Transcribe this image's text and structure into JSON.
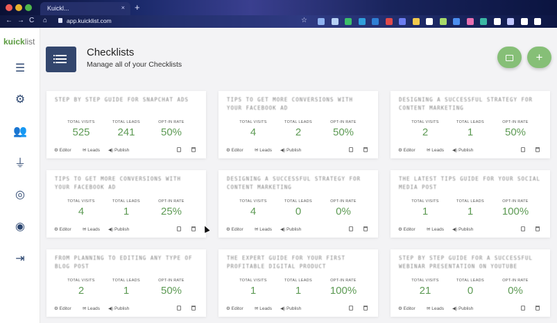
{
  "browser": {
    "tab_title": "Kuickl...",
    "tab_close": "×",
    "new_tab": "+",
    "url": "app.kuicklist.com",
    "nav": {
      "back": "←",
      "forward": "→",
      "reload": "C",
      "home": "⌂",
      "bookmark": "☆"
    },
    "extension_colors": [
      "#8fb2f0",
      "#b7d1f5",
      "#3cbf6a",
      "#2f9edb",
      "#2f7fd4",
      "#e04b4b",
      "#6b7cf0",
      "#f2c94c",
      "#ffffff",
      "#a6d96a",
      "#4b8ef0",
      "#e86fb0",
      "#3bb7a3",
      "#ffffff",
      "#c0c6ff",
      "#ffffff",
      "#ffffff"
    ]
  },
  "sidebar": {
    "logo_primary": "kuick",
    "logo_secondary": "list",
    "items": [
      {
        "icon": "list-icon",
        "glyph": "☰"
      },
      {
        "icon": "gear-icon",
        "glyph": "⚙"
      },
      {
        "icon": "users-icon",
        "glyph": "👥"
      },
      {
        "icon": "plug-icon",
        "glyph": "⏚"
      },
      {
        "icon": "life-ring-icon",
        "glyph": "◎"
      },
      {
        "icon": "user-circle-icon",
        "glyph": "◉"
      },
      {
        "icon": "sign-out-icon",
        "glyph": "⇥"
      }
    ]
  },
  "header": {
    "title": "Checklists",
    "subtitle": "Manage all of your Checklists",
    "add_label": "+"
  },
  "labels": {
    "visits": "TOTAL VISITS",
    "leads": "TOTAL LEADS",
    "optin": "OPT-IN RATE",
    "editor": "⚙ Editor",
    "leads_action": "✉ Leads",
    "publish": "◀) Publish"
  },
  "accent_color": "#86bf77",
  "cards": [
    {
      "title": "STEP BY STEP GUIDE FOR SNAPCHAT ADS",
      "visits": "525",
      "leads": "241",
      "rate": "50%"
    },
    {
      "title": "TIPS TO GET MORE CONVERSIONS WITH YOUR FACEBOOK AD",
      "visits": "4",
      "leads": "2",
      "rate": "50%"
    },
    {
      "title": "DESIGNING A SUCCESSFUL STRATEGY FOR CONTENT MARKETING",
      "visits": "2",
      "leads": "1",
      "rate": "50%"
    },
    {
      "title": "TIPS TO GET MORE CONVERSIONS WITH YOUR FACEBOOK AD",
      "visits": "4",
      "leads": "1",
      "rate": "25%"
    },
    {
      "title": "DESIGNING A SUCCESSFUL STRATEGY FOR CONTENT MARKETING",
      "visits": "4",
      "leads": "0",
      "rate": "0%"
    },
    {
      "title": "THE LATEST TIPS GUIDE FOR YOUR SOCIAL MEDIA POST",
      "visits": "1",
      "leads": "1",
      "rate": "100%"
    },
    {
      "title": "FROM PLANNING TO EDITING ANY TYPE OF BLOG POST",
      "visits": "2",
      "leads": "1",
      "rate": "50%"
    },
    {
      "title": "THE EXPERT GUIDE FOR YOUR FIRST PROFITABLE DIGITAL PRODUCT",
      "visits": "1",
      "leads": "1",
      "rate": "100%"
    },
    {
      "title": "STEP BY STEP GUIDE FOR A SUCCESSFUL WEBINAR PRESENTATION ON YOUTUBE",
      "visits": "21",
      "leads": "0",
      "rate": "0%"
    }
  ]
}
